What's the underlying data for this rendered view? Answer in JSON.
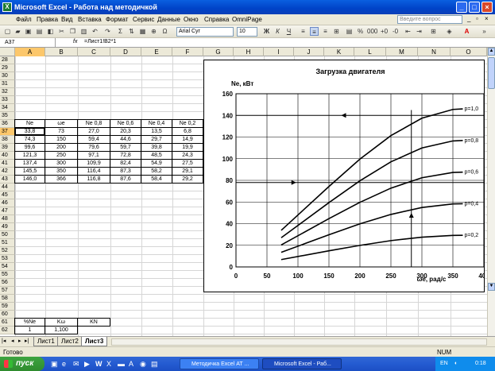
{
  "window": {
    "title": "Microsoft Excel - Работа над методичкой"
  },
  "menu": {
    "items": [
      "Файл",
      "Правка",
      "Вид",
      "Вставка",
      "Формат",
      "Сервис",
      "Данные",
      "Окно",
      "Справка",
      "OmniPage"
    ],
    "ask_placeholder": "Введите вопрос"
  },
  "toolbar": {
    "font": "Arial Cyr",
    "size": "10",
    "bold": "Ж",
    "italic": "К",
    "underline": "Ч"
  },
  "formula": {
    "namebox": "A37",
    "fx": "fx",
    "content": "=Лист1!B2*1"
  },
  "columns": [
    "A",
    "B",
    "C",
    "D",
    "E",
    "F",
    "G",
    "H",
    "I",
    "J",
    "K",
    "L",
    "M",
    "N",
    "O"
  ],
  "rows": [
    "28",
    "29",
    "30",
    "31",
    "32",
    "33",
    "34",
    "35",
    "36",
    "37",
    "38",
    "39",
    "40",
    "41",
    "42",
    "43",
    "44",
    "45",
    "46",
    "47",
    "48",
    "49",
    "50",
    "51",
    "52",
    "53",
    "54",
    "55",
    "56",
    "57",
    "58",
    "59",
    "60",
    "61",
    "62"
  ],
  "table": {
    "header": [
      "Ne",
      "ωe",
      "Ne 0,8",
      "Ne 0,6",
      "Ne 0,4",
      "Ne 0,2"
    ],
    "rows": [
      [
        "33,8",
        "73",
        "27,0",
        "20,3",
        "13,5",
        "6,8"
      ],
      [
        "74,3",
        "150",
        "59,4",
        "44,6",
        "29,7",
        "14,9"
      ],
      [
        "99,6",
        "200",
        "79,6",
        "59,7",
        "39,8",
        "19,9"
      ],
      [
        "121,3",
        "250",
        "97,1",
        "72,8",
        "48,5",
        "24,3"
      ],
      [
        "137,4",
        "300",
        "109,9",
        "82,4",
        "54,9",
        "27,5"
      ],
      [
        "145,5",
        "350",
        "116,4",
        "87,3",
        "58,2",
        "29,1"
      ],
      [
        "146,0",
        "366",
        "116,8",
        "87,6",
        "58,4",
        "29,2"
      ]
    ],
    "row61": [
      "%Ne",
      "Kω",
      "KN"
    ],
    "row62": [
      "1",
      "1,100"
    ]
  },
  "sheets": [
    "Лист1",
    "Лист2",
    "Лист3"
  ],
  "active_sheet": "Лист3",
  "status": {
    "left": "Готово",
    "num": "NUM"
  },
  "taskbar": {
    "start": "пуск",
    "tasks": [
      "Методичка Excel АТ ...",
      "Microsoft Excel - Раб..."
    ],
    "lang": "EN",
    "clock": "0:18"
  },
  "chart_data": {
    "type": "line",
    "title": "Загрузка двигателя",
    "ylabel": "Ne, кВт",
    "xlabel": "ωe, рад/с",
    "xlim": [
      0,
      400
    ],
    "ylim": [
      0,
      160
    ],
    "xticks": [
      "0",
      "50",
      "100",
      "150",
      "200",
      "250",
      "300",
      "350",
      "400"
    ],
    "yticks": [
      "0",
      "20",
      "40",
      "60",
      "80",
      "100",
      "120",
      "140",
      "160"
    ],
    "grid": true,
    "x": [
      73,
      150,
      200,
      250,
      300,
      350,
      366
    ],
    "series": [
      {
        "name": "p=1,0",
        "values": [
          33.8,
          74.3,
          99.6,
          121.3,
          137.4,
          145.5,
          146.0
        ]
      },
      {
        "name": "p=0,8",
        "values": [
          27.0,
          59.4,
          79.6,
          97.1,
          109.9,
          116.4,
          116.8
        ]
      },
      {
        "name": "p=0,6",
        "values": [
          20.3,
          44.6,
          59.7,
          72.8,
          82.4,
          87.3,
          87.6
        ]
      },
      {
        "name": "p=0,4",
        "values": [
          13.5,
          29.7,
          39.8,
          48.5,
          54.9,
          58.2,
          58.4
        ]
      },
      {
        "name": "p=0,2",
        "values": [
          6.8,
          14.9,
          19.9,
          24.3,
          27.5,
          29.1,
          29.2
        ]
      }
    ],
    "markers": {
      "horizontal_y": [
        140,
        78
      ],
      "vertical_x": 283
    }
  }
}
